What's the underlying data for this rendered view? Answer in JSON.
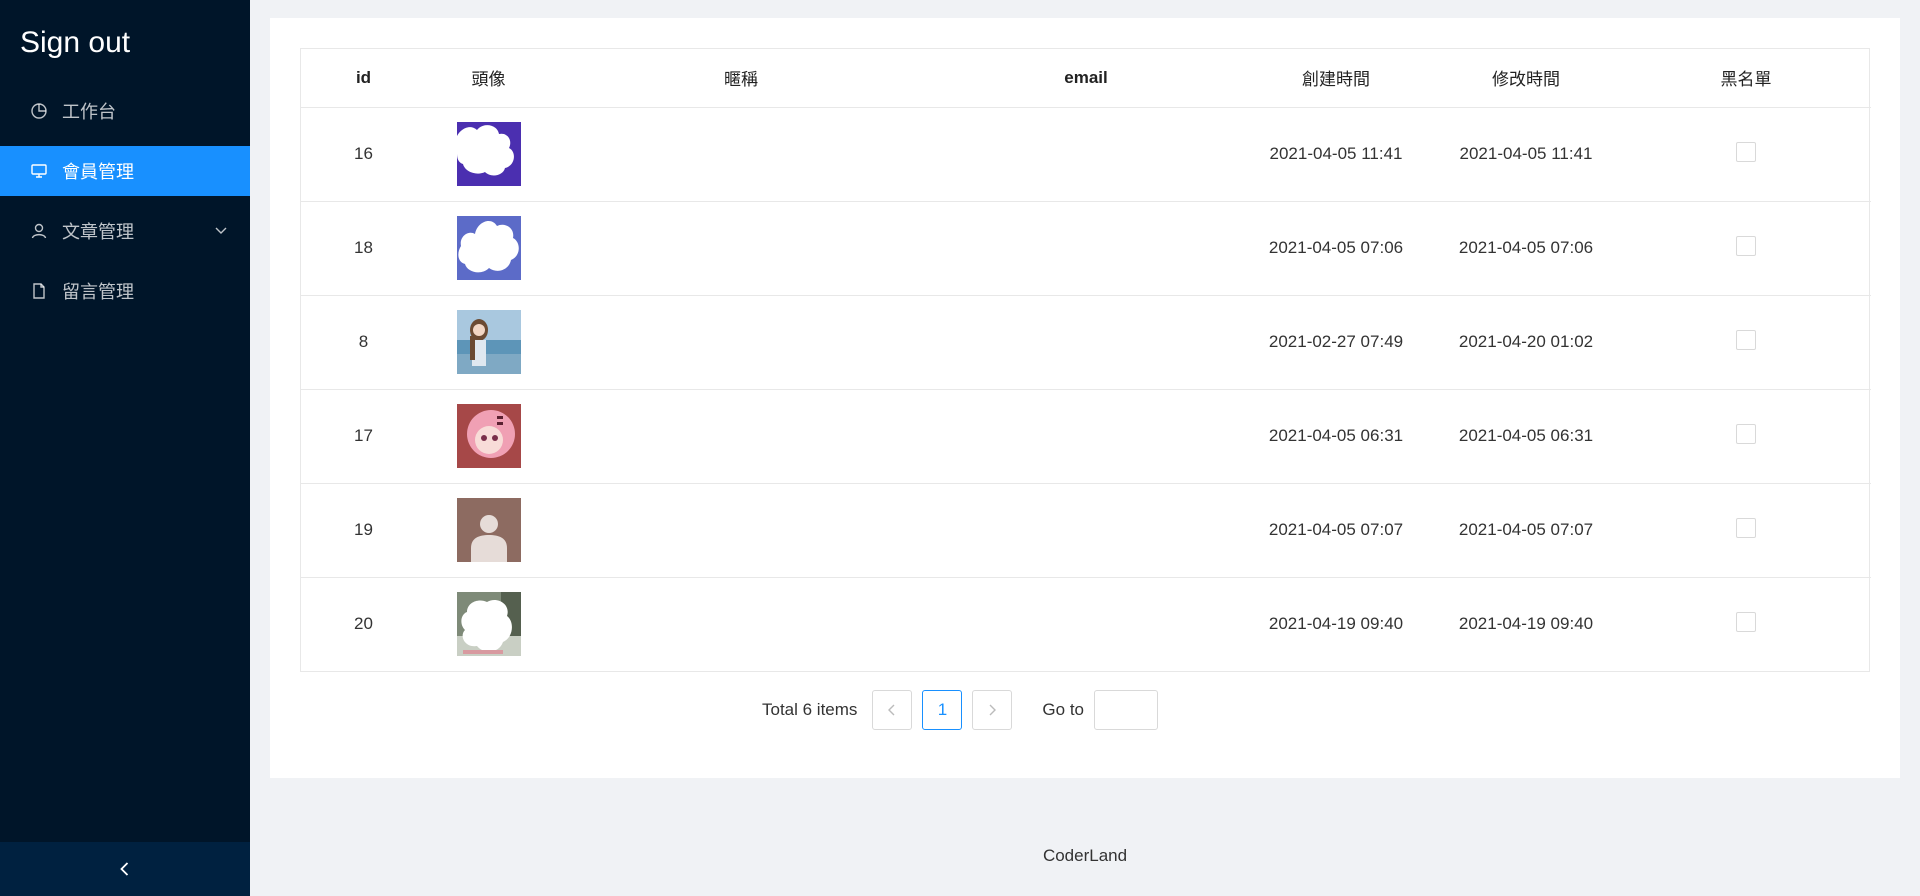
{
  "sidebar": {
    "brand": "Sign out",
    "items": [
      {
        "label": "工作台",
        "icon": "pie-chart-icon",
        "active": false
      },
      {
        "label": "會員管理",
        "icon": "desktop-icon",
        "active": true
      },
      {
        "label": "文章管理",
        "icon": "user-icon",
        "active": false,
        "submenu": true
      },
      {
        "label": "留言管理",
        "icon": "file-icon",
        "active": false
      }
    ],
    "collapse_icon": "chevron-left-icon"
  },
  "table": {
    "columns": [
      "id",
      "頭像",
      "暱稱",
      "email",
      "創建時間",
      "修改時間",
      "黑名單"
    ],
    "rows": [
      {
        "id": "16",
        "avatar": "avatar-purple-blob",
        "nickname": "",
        "email": "",
        "created": "2021-04-05 11:41",
        "modified": "2021-04-05 11:41",
        "blacklist": false
      },
      {
        "id": "18",
        "avatar": "avatar-blue-blob",
        "nickname": "",
        "email": "",
        "created": "2021-04-05 07:06",
        "modified": "2021-04-05 07:06",
        "blacklist": false
      },
      {
        "id": "8",
        "avatar": "avatar-beach-girl",
        "nickname": "",
        "email": "",
        "created": "2021-02-27 07:49",
        "modified": "2021-04-20 01:02",
        "blacklist": false
      },
      {
        "id": "17",
        "avatar": "avatar-pink-anime",
        "nickname": "",
        "email": "",
        "created": "2021-04-05 06:31",
        "modified": "2021-04-05 06:31",
        "blacklist": false
      },
      {
        "id": "19",
        "avatar": "avatar-default-person",
        "nickname": "",
        "email": "",
        "created": "2021-04-05 07:07",
        "modified": "2021-04-05 07:07",
        "blacklist": false
      },
      {
        "id": "20",
        "avatar": "avatar-green-blob",
        "nickname": "",
        "email": "",
        "created": "2021-04-19 09:40",
        "modified": "2021-04-19 09:40",
        "blacklist": false
      }
    ]
  },
  "pagination": {
    "total_label": "Total 6 items",
    "current_page": "1",
    "goto_label": "Go to",
    "goto_value": ""
  },
  "footer": {
    "text": "CoderLand"
  },
  "colors": {
    "sidebar_bg": "#001529",
    "active": "#1890ff",
    "collapse_bg": "#002140"
  }
}
